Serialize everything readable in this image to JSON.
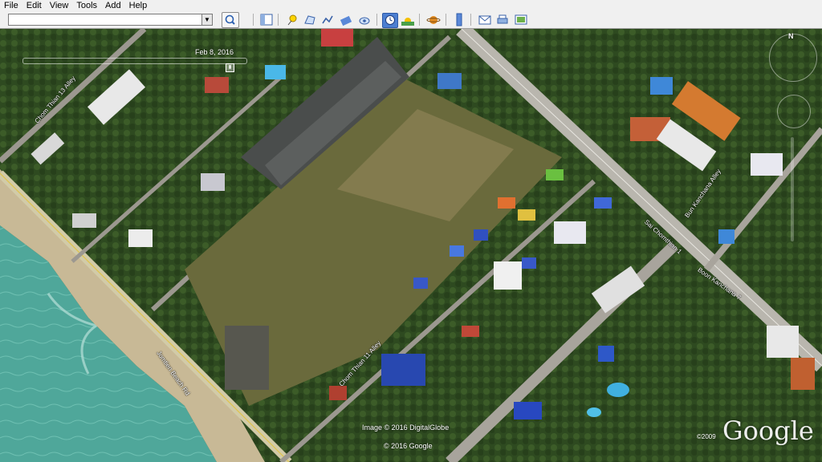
{
  "menu": [
    "File",
    "Edit",
    "View",
    "Tools",
    "Add",
    "Help"
  ],
  "toolbar": {
    "search_value": "",
    "buttons": [
      "sidebar-icon",
      "placemark-icon",
      "polygon-icon",
      "path-icon",
      "overlay-icon",
      "record-tour-icon",
      "historical-imagery-icon",
      "sun-icon",
      "planets-icon",
      "ruler-icon",
      "email-icon",
      "print-icon",
      "save-image-icon"
    ]
  },
  "map": {
    "date": "Feb  8, 2016",
    "north": "N",
    "roads": [
      "Chom Thian 13 Alley",
      "Jomtien Beach Rd",
      "Chom Thian 11 Alley",
      "Sai Chomthian 1",
      "Bun Kanchana Alley",
      "Boon Kanchana 7"
    ],
    "attribution": {
      "imagery": "Image © 2016 DigitalGlobe",
      "copyright": "© 2016 Google",
      "year": "©2009",
      "logo": "Google"
    }
  },
  "colors": {
    "water": "#4fa79a",
    "vegetation": "#2f4a22",
    "field": "#6a6a3c",
    "road": "#b9b6ae",
    "ui_bg": "#f0f0f0"
  }
}
